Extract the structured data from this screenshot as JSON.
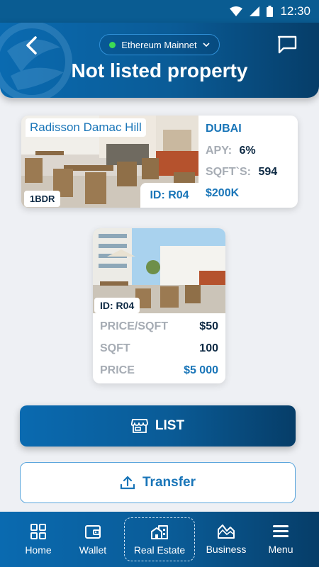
{
  "status_bar": {
    "time": "12:30",
    "icons": [
      "wifi-icon",
      "cell-signal-icon",
      "battery-icon"
    ]
  },
  "header": {
    "network": "Ethereum Mainnet",
    "title": "Not listed property"
  },
  "property": {
    "name": "Radisson Damac Hill",
    "bedrooms": "1BDR",
    "id": "ID: R04",
    "city": "DUBAI",
    "apy_label": "APY:",
    "apy_value": "6%",
    "sqft_label": "SQFT`S:",
    "sqft_value": "594",
    "price": "$200K"
  },
  "token": {
    "id": "ID: R04",
    "rows": [
      {
        "label": "PRICE/SQFT",
        "value": "$50"
      },
      {
        "label": "SQFT",
        "value": "100"
      },
      {
        "label": "PRICE",
        "value": "$5 000"
      }
    ]
  },
  "actions": {
    "list_label": "LIST",
    "transfer_label": "Transfer"
  },
  "nav": {
    "items": [
      {
        "label": "Home",
        "icon": "home-grid-icon"
      },
      {
        "label": "Wallet",
        "icon": "wallet-icon"
      },
      {
        "label": "Real Estate",
        "icon": "real-estate-icon",
        "active": true
      },
      {
        "label": "Business",
        "icon": "business-chart-icon"
      },
      {
        "label": "Menu",
        "icon": "menu-icon"
      }
    ]
  },
  "colors": {
    "primary": "#0a6ab0",
    "accent": "#1975b8",
    "muted": "#a6acb4",
    "dark": "#0e2a44",
    "online": "#3ddc55"
  }
}
